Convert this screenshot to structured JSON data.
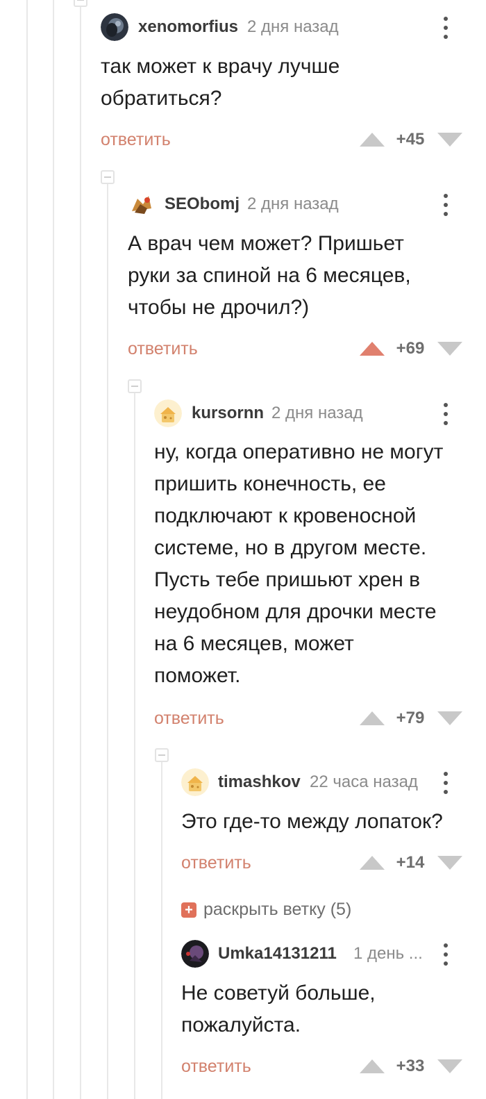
{
  "comments": [
    {
      "username": "xenomorfius",
      "time": "2 дня назад",
      "text_lines": [
        "так может к врачу лучше",
        "обратиться?"
      ],
      "reply_label": "ответить",
      "score": "+45",
      "upvoted": false
    },
    {
      "username": "SEObomj",
      "time": "2 дня назад",
      "text_lines": [
        "А врач чем может? Пришьет",
        "руки за спиной на 6 месяцев,",
        "чтобы не дрочил?)"
      ],
      "reply_label": "ответить",
      "score": "+69",
      "upvoted": true
    },
    {
      "username": "kursornn",
      "time": "2 дня назад",
      "text_lines": [
        "ну, когда оперативно не могут",
        "пришить конечность, ее",
        "подключают к кровеносной",
        "системе, но в другом месте.",
        "Пусть тебе пришьют хрен в",
        "неудобном для дрочки месте",
        "на 6 месяцев, может",
        "поможет."
      ],
      "reply_label": "ответить",
      "score": "+79",
      "upvoted": false
    },
    {
      "username": "timashkov",
      "time": "22 часа назад",
      "text_lines": [
        "Это где-то между лопаток?"
      ],
      "reply_label": "ответить",
      "score": "+14",
      "upvoted": false
    },
    {
      "username": "Umka14131211",
      "time": "1 день ...",
      "text_lines": [
        "Не советуй больше,",
        "пожалуйста."
      ],
      "reply_label": "ответить",
      "score": "+33",
      "upvoted": false
    }
  ],
  "expand_thread": {
    "icon": "plus-icon",
    "label": "раскрыть ветку (5)"
  },
  "colors": {
    "accent": "#d2816d",
    "upvote_active": "#e0806e",
    "vote_inactive": "#c8c8c8",
    "thread_line": "#e8e8e8"
  }
}
